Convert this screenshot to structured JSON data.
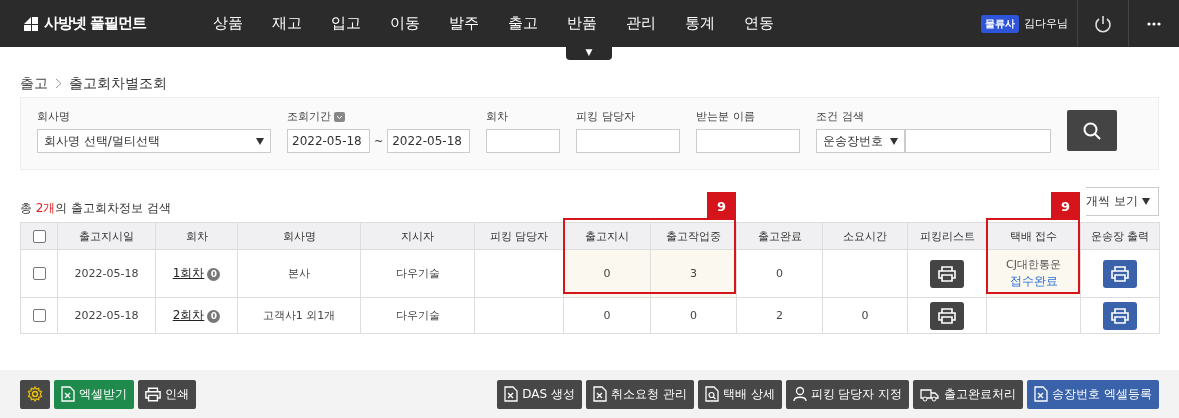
{
  "nav": {
    "logo": "사방넷 풀필먼트",
    "menu": [
      "상품",
      "재고",
      "입고",
      "이동",
      "발주",
      "출고",
      "반품",
      "관리",
      "통계",
      "연동"
    ],
    "menu_toggle": "▼",
    "user_badge": "물류사",
    "user_name": "김다우님"
  },
  "breadcrumb": [
    "출고",
    "출고회차별조회"
  ],
  "filters": {
    "company": {
      "label": "회사명",
      "value": "회사명 선택/멀티선택"
    },
    "period": {
      "label": "조회기간",
      "from": "2022-05-18",
      "separator": "~",
      "to": "2022-05-18"
    },
    "round": {
      "label": "회차"
    },
    "picker": {
      "label": "피킹 담당자"
    },
    "receiver": {
      "label": "받는분 이름"
    },
    "condition": {
      "label": "조건 검색",
      "value": "운송장번호"
    }
  },
  "summary": {
    "prefix": "총 ",
    "count": "2개",
    "suffix": "의 출고회차정보 검색"
  },
  "page_size": {
    "value": "개씩 보기"
  },
  "table": {
    "select_all_checked": false,
    "columns": [
      "출고지시일",
      "회차",
      "회사명",
      "지시자",
      "피킹 담당자",
      "출고지시",
      "출고작업중",
      "출고완료",
      "소요시간",
      "피킹리스트",
      "택배 접수",
      "운송장 출력"
    ],
    "rows": [
      {
        "checked": false,
        "date": "2022-05-18",
        "round": "1회차",
        "round_badge": "0",
        "company": "본사",
        "director": "다우기술",
        "ordered": "0",
        "working": "3",
        "done": "0",
        "courier": {
          "company": "CJ대한통운",
          "status": "접수완료"
        }
      },
      {
        "checked": false,
        "date": "2022-05-18",
        "round": "2회차",
        "round_badge": "0",
        "company": "고객사1 외1개",
        "director": "다우기술",
        "ordered": "0",
        "working": "0",
        "done": "2",
        "elapsed": "0"
      }
    ]
  },
  "annotations": [
    {
      "label": "9"
    },
    {
      "label": "9"
    }
  ],
  "toolbar": {
    "left": [
      {
        "kind": "dark"
      },
      {
        "kind": "green",
        "label": "엑셀받기"
      },
      {
        "kind": "dark",
        "label": "인쇄"
      }
    ],
    "right": [
      {
        "kind": "dark",
        "label": "DAS 생성"
      },
      {
        "kind": "dark",
        "label": "취소요청 관리"
      },
      {
        "kind": "dark",
        "label": "택배 상세"
      },
      {
        "kind": "dark",
        "label": "피킹 담당자 지정"
      },
      {
        "kind": "dark",
        "label": "출고완료처리"
      },
      {
        "kind": "blue",
        "label": "송장번호 엑셀등록"
      }
    ]
  }
}
